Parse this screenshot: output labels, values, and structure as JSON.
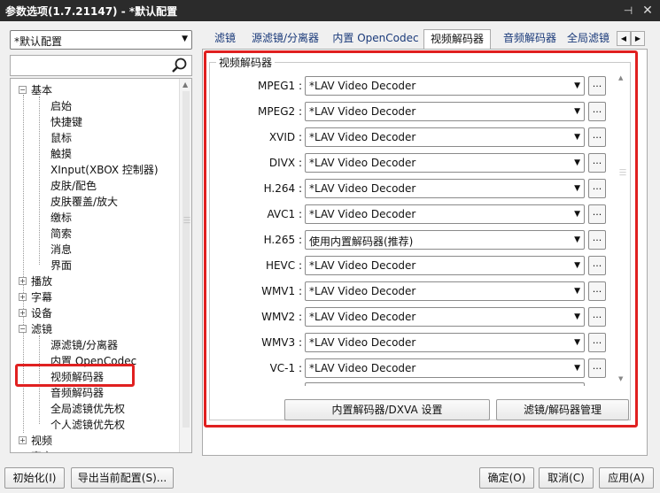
{
  "window": {
    "title": "参数选项(1.7.21147) - *默认配置",
    "pin_glyph": "⊣",
    "close_glyph": "✕"
  },
  "profile": {
    "selected": "*默认配置"
  },
  "search": {
    "placeholder": ""
  },
  "tree": {
    "basic": {
      "label": "基本",
      "children": [
        "启始",
        "快捷键",
        "鼠标",
        "触摸",
        "XInput(XBOX 控制器)",
        "皮肤/配色",
        "皮肤覆盖/放大",
        "缴标",
        "简索",
        "消息",
        "界面"
      ]
    },
    "play": {
      "label": "播放"
    },
    "subtitle": {
      "label": "字幕"
    },
    "device": {
      "label": "设备"
    },
    "filter": {
      "label": "滤镜",
      "children": [
        "源滤镜/分离器",
        "内置 OpenCodec",
        "视频解码器",
        "音频解码器",
        "全局滤镜优先权",
        "个人滤镜优先权"
      ]
    },
    "video": {
      "label": "视频"
    },
    "audio": {
      "label": "声音"
    }
  },
  "tabs": [
    "滤镜",
    "源滤镜/分离器",
    "内置 OpenCodec",
    "视频解码器",
    "音频解码器",
    "全局滤镜"
  ],
  "active_tab": "视频解码器",
  "group": {
    "title": "视频解码器",
    "more_label": "...",
    "rows": [
      {
        "label": "MPEG1 :",
        "value": "*LAV Video Decoder"
      },
      {
        "label": "MPEG2 :",
        "value": "*LAV Video Decoder"
      },
      {
        "label": "XVID :",
        "value": "*LAV Video Decoder"
      },
      {
        "label": "DIVX :",
        "value": "*LAV Video Decoder"
      },
      {
        "label": "H.264 :",
        "value": "*LAV Video Decoder"
      },
      {
        "label": "AVC1 :",
        "value": "*LAV Video Decoder"
      },
      {
        "label": "H.265 :",
        "value": "使用内置解码器(推荐)"
      },
      {
        "label": "HEVC :",
        "value": "*LAV Video Decoder"
      },
      {
        "label": "WMV1 :",
        "value": "*LAV Video Decoder"
      },
      {
        "label": "WMV2 :",
        "value": "*LAV Video Decoder"
      },
      {
        "label": "WMV3 :",
        "value": "*LAV Video Decoder"
      },
      {
        "label": "VC-1 :",
        "value": "*LAV Video Decoder"
      }
    ],
    "dxva_button": "内置解码器/DXVA 设置",
    "manage_button": "滤镜/解码器管理"
  },
  "footer": {
    "init_button": "初始化(I)",
    "export_button": "导出当前配置(S)...",
    "ok_button": "确定(O)",
    "cancel_button": "取消(C)",
    "apply_button": "应用(A)"
  },
  "colors": {
    "titlebar": "#2b2b2b",
    "highlight": "#e02020",
    "tab_link": "#1a3a7a"
  }
}
